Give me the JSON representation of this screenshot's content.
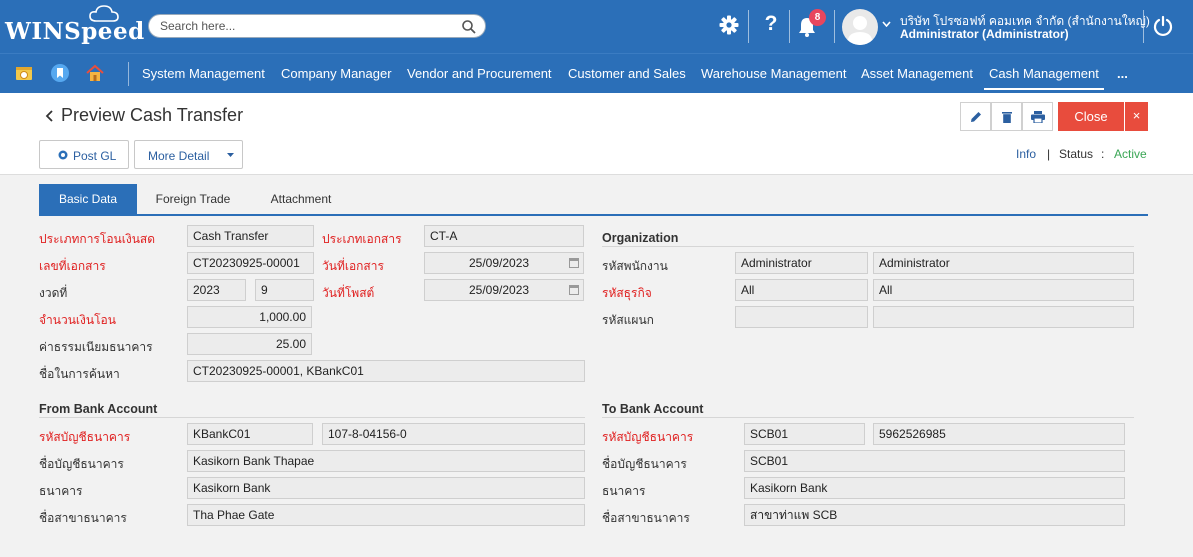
{
  "header": {
    "logo": "WINSpeed",
    "search_placeholder": "Search here...",
    "notification_count": "8",
    "company": "บริษัท โปรซอฟท์ คอมเทค จำกัด (สำนักงานใหญ่)",
    "user": "Administrator (Administrator)"
  },
  "menu": {
    "items": [
      "System Management",
      "Company Manager",
      "Vendor and Procurement",
      "Customer and Sales",
      "Warehouse Management",
      "Asset Management",
      "Cash Management",
      "..."
    ]
  },
  "page": {
    "title": "Preview Cash Transfer",
    "post_gl": "Post GL",
    "more_detail": "More Detail",
    "close": "Close",
    "close_x": "×",
    "info": "Info",
    "separator": "|",
    "status_label": "Status",
    "status_colon": ":",
    "status_value": "Active"
  },
  "tabs": [
    "Basic Data",
    "Foreign Trade",
    "Attachment"
  ],
  "basic": {
    "transfer_type_label": "ประเภทการโอนเงินสด",
    "transfer_type": "Cash Transfer",
    "doc_type_label": "ประเภทเอกสาร",
    "doc_type": "CT-A",
    "doc_no_label": "เลขที่เอกสาร",
    "doc_no": "CT20230925-00001",
    "doc_date_label": "วันที่เอกสาร",
    "doc_date": "25/09/2023",
    "period_label": "งวดที่",
    "period_year": "2023",
    "period_month": "9",
    "post_date_label": "วันที่โพสต์",
    "post_date": "25/09/2023",
    "amount_label": "จำนวนเงินโอน",
    "amount": "1,000.00",
    "fee_label": "ค่าธรรมเนียมธนาคาร",
    "fee": "25.00",
    "search_name_label": "ชื่อในการค้นหา",
    "search_name": "CT20230925-00001, KBankC01"
  },
  "organization": {
    "title": "Organization",
    "employee_label": "รหัสพนักงาน",
    "employee_code": "Administrator",
    "employee_name": "Administrator",
    "business_label": "รหัสธุรกิจ",
    "business_code": "All",
    "business_name": "All",
    "department_label": "รหัสแผนก",
    "department_code": "",
    "department_name": ""
  },
  "from_bank": {
    "title": "From Bank Account",
    "account_code_label": "รหัสบัญชีธนาคาร",
    "account_code": "KBankC01",
    "account_no": "107-8-04156-0",
    "account_name_label": "ชื่อบัญชีธนาคาร",
    "account_name": "Kasikorn Bank Thapae",
    "bank_label": "ธนาคาร",
    "bank": "Kasikorn Bank",
    "branch_label": "ชื่อสาขาธนาคาร",
    "branch": "Tha Phae Gate"
  },
  "to_bank": {
    "title": "To Bank Account",
    "account_code_label": "รหัสบัญชีธนาคาร",
    "account_code": "SCB01",
    "account_no": "5962526985",
    "account_name_label": "ชื่อบัญชีธนาคาร",
    "account_name": "SCB01",
    "bank_label": "ธนาคาร",
    "bank": "Kasikorn Bank",
    "branch_label": "ชื่อสาขาธนาคาร",
    "branch": "สาขาท่าแพ SCB"
  },
  "colors": {
    "brand": "#2b6fb8",
    "danger": "#e84c3d",
    "required": "#e02020",
    "active": "#3aa655"
  }
}
